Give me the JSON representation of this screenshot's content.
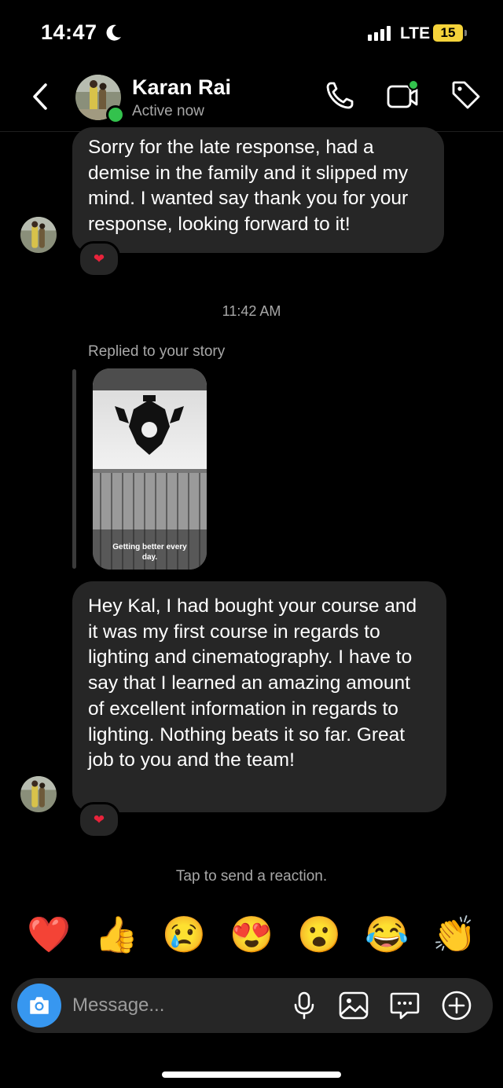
{
  "status_bar": {
    "time": "14:47",
    "network": "LTE",
    "battery": "15"
  },
  "header": {
    "name": "Karan Rai",
    "status": "Active now"
  },
  "messages": [
    {
      "text": "Sorry for the late response, had a demise in the family and it slipped my mind. I wanted say thank you for your response, looking forward to it!",
      "reaction": "❤"
    },
    {
      "text": "Hey Kal, I had bought your course and it was my first course in regards to lighting and cinematography. I have to say that I learned an amazing amount of excellent information in regards to lighting. Nothing beats it so far. Great job to you and the team!",
      "reaction": "❤"
    }
  ],
  "timestamp": "11:42 AM",
  "story_reply": {
    "label": "Replied to your story",
    "caption": "Getting better every day."
  },
  "tap_hint": "Tap to send a reaction.",
  "quick_reactions": [
    "❤️",
    "👍",
    "😢",
    "😍",
    "😮",
    "😂",
    "👏"
  ],
  "composer": {
    "placeholder": "Message..."
  }
}
